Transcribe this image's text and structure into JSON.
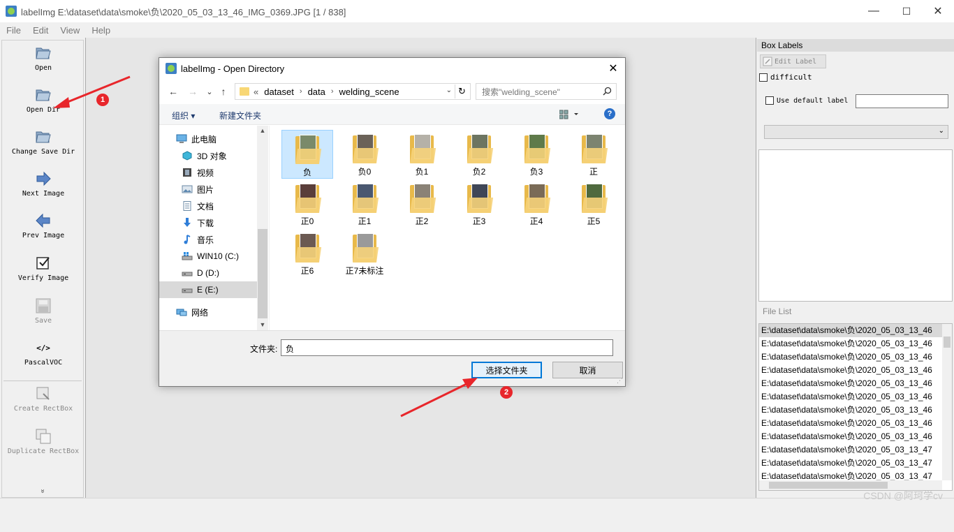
{
  "window": {
    "title": "labelImg E:\\dataset\\data\\smoke\\负\\2020_05_03_13_46_IMG_0369.JPG [1 / 838]",
    "minimize": "—",
    "maximize": "☐",
    "close": "✕"
  },
  "menu": [
    "File",
    "Edit",
    "View",
    "Help"
  ],
  "toolbar": {
    "open": "Open",
    "open_dir": "Open Dir",
    "change_save_dir": "Change Save Dir",
    "next_image": "Next Image",
    "prev_image": "Prev Image",
    "verify_image": "Verify Image",
    "save": "Save",
    "format": "PascalVOC",
    "format_icon": "</>",
    "create_rectbox": "Create RectBox",
    "duplicate_rectbox": "Duplicate RectBox",
    "more": "»"
  },
  "right_dock": {
    "box_labels_title": "Box Labels",
    "edit_label": "Edit Label",
    "difficult": "difficult",
    "use_default_label": "Use default label",
    "default_label_value": "",
    "file_list_title": "File List",
    "files": [
      "E:\\dataset\\data\\smoke\\负\\2020_05_03_13_46",
      "E:\\dataset\\data\\smoke\\负\\2020_05_03_13_46",
      "E:\\dataset\\data\\smoke\\负\\2020_05_03_13_46",
      "E:\\dataset\\data\\smoke\\负\\2020_05_03_13_46",
      "E:\\dataset\\data\\smoke\\负\\2020_05_03_13_46",
      "E:\\dataset\\data\\smoke\\负\\2020_05_03_13_46",
      "E:\\dataset\\data\\smoke\\负\\2020_05_03_13_46",
      "E:\\dataset\\data\\smoke\\负\\2020_05_03_13_46",
      "E:\\dataset\\data\\smoke\\负\\2020_05_03_13_46",
      "E:\\dataset\\data\\smoke\\负\\2020_05_03_13_47",
      "E:\\dataset\\data\\smoke\\负\\2020_05_03_13_47",
      "E:\\dataset\\data\\smoke\\负\\2020_05_03_13_47"
    ]
  },
  "dialog": {
    "title": "labelImg - Open Directory",
    "close": "✕",
    "back": "←",
    "forward": "→",
    "recent": "⌄",
    "up": "↑",
    "address": {
      "overflow": "«",
      "segments": [
        "dataset",
        "data",
        "welding_scene"
      ],
      "separator": "›"
    },
    "refresh": "↻",
    "search_placeholder": "搜索\"welding_scene\"",
    "organize": "组织 ▾",
    "new_folder": "新建文件夹",
    "help": "?",
    "nav_items": [
      "此电脑",
      "3D 对象",
      "视频",
      "图片",
      "文档",
      "下载",
      "音乐",
      "WIN10 (C:)",
      "D (D:)",
      "E (E:)",
      "网络"
    ],
    "folders": [
      "负",
      "负0",
      "负1",
      "负2",
      "负3",
      "正",
      "正0",
      "正1",
      "正2",
      "正3",
      "正4",
      "正5",
      "正6",
      "正7未标注"
    ],
    "folder_label": "文件夹:",
    "folder_value": "负",
    "select_button": "选择文件夹",
    "cancel_button": "取消"
  },
  "annotations": {
    "badge1": "1",
    "badge2": "2",
    "color": "#e8262b"
  },
  "watermark": "CSDN @阿珂学cv"
}
